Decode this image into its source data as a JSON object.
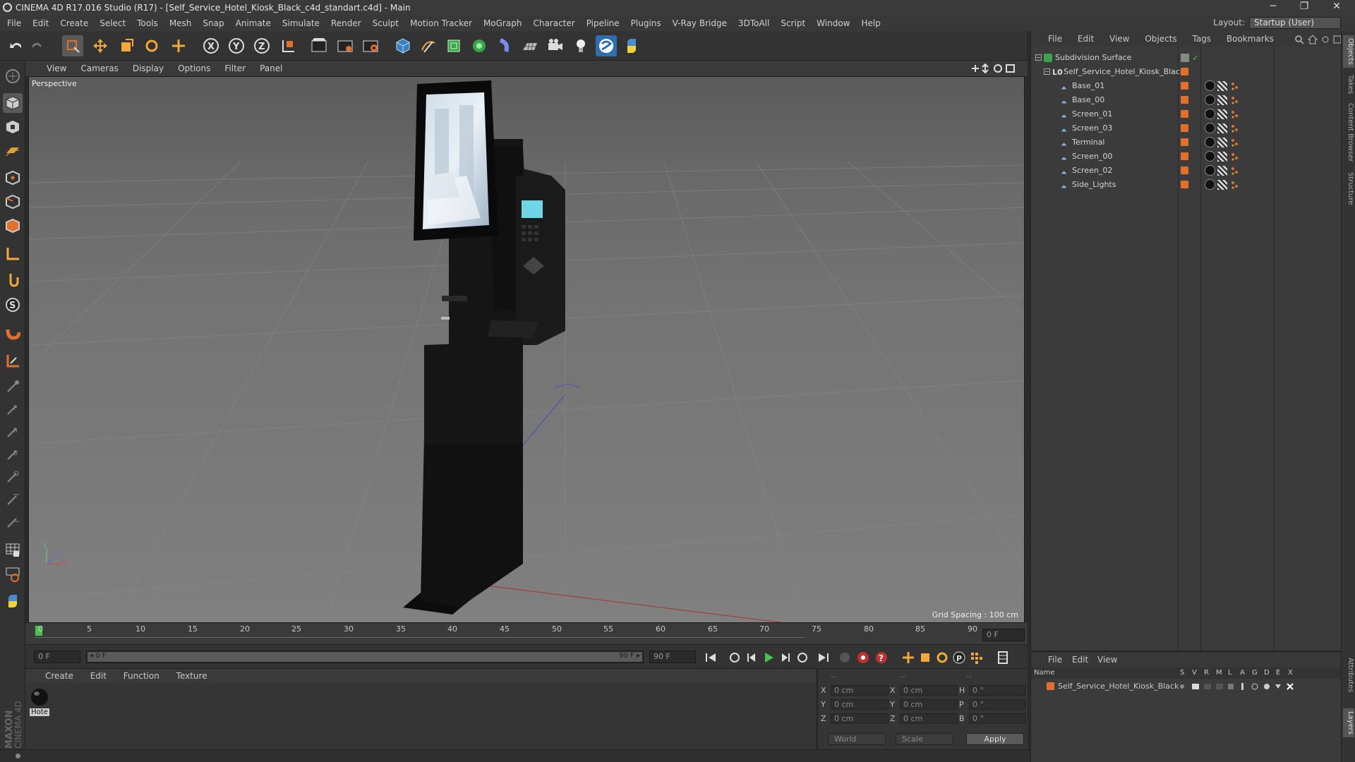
{
  "window": {
    "title": "CINEMA 4D R17.016 Studio (R17) - [Self_Service_Hotel_Kiosk_Black_c4d_standart.c4d] - Main",
    "minimize": "─",
    "restore": "❐",
    "close": "✕"
  },
  "menu": [
    "File",
    "Edit",
    "Create",
    "Select",
    "Tools",
    "Mesh",
    "Snap",
    "Animate",
    "Simulate",
    "Render",
    "Sculpt",
    "Motion Tracker",
    "MoGraph",
    "Character",
    "Pipeline",
    "Plugins",
    "V-Ray Bridge",
    "3DToAll",
    "Script",
    "Window",
    "Help"
  ],
  "layout": {
    "label": "Layout:",
    "value": "Startup (User)"
  },
  "viewport": {
    "menu": [
      "View",
      "Cameras",
      "Display",
      "Options",
      "Filter",
      "Panel"
    ],
    "camera_label": "Perspective",
    "grid_spacing": "Grid Spacing : 100 cm",
    "axis_y": "Y",
    "axis_z": "Z",
    "axis_x": "X"
  },
  "timeline": {
    "ticks": [
      "0",
      "5",
      "10",
      "15",
      "20",
      "25",
      "30",
      "35",
      "40",
      "45",
      "50",
      "55",
      "60",
      "65",
      "70",
      "75",
      "80",
      "85",
      "90"
    ],
    "current_frame": "0 F",
    "start": "0 F",
    "range_start": "◂ 0 F",
    "range_end": "90 F ▸",
    "end": "90 F"
  },
  "material_manager": {
    "menu": [
      "Create",
      "Edit",
      "Function",
      "Texture"
    ],
    "materials": [
      {
        "name": "Hote"
      }
    ]
  },
  "coordinates": {
    "headers": [
      "--",
      "--",
      "--"
    ],
    "rows": [
      {
        "a": "X",
        "av": "0 cm",
        "b": "X",
        "bv": "0 cm",
        "c": "H",
        "cv": "0 °"
      },
      {
        "a": "Y",
        "av": "0 cm",
        "b": "Y",
        "bv": "0 cm",
        "c": "P",
        "cv": "0 °"
      },
      {
        "a": "Z",
        "av": "0 cm",
        "b": "Z",
        "bv": "0 cm",
        "c": "B",
        "cv": "0 °"
      }
    ],
    "mode1": "World",
    "mode2": "Scale",
    "apply": "Apply"
  },
  "object_manager": {
    "menu": [
      "File",
      "Edit",
      "View",
      "Objects",
      "Tags",
      "Bookmarks"
    ],
    "objects": [
      {
        "name": "Subdivision Surface",
        "level": 0
      },
      {
        "name": "Self_Service_Hotel_Kiosk_Black",
        "level": 1
      },
      {
        "name": "Base_01",
        "level": 2
      },
      {
        "name": "Base_00",
        "level": 2
      },
      {
        "name": "Screen_01",
        "level": 2
      },
      {
        "name": "Screen_03",
        "level": 2
      },
      {
        "name": "Terminal",
        "level": 2
      },
      {
        "name": "Screen_00",
        "level": 2
      },
      {
        "name": "Screen_02",
        "level": 2
      },
      {
        "name": "Side_Lights",
        "level": 2
      }
    ]
  },
  "layer_manager": {
    "menu": [
      "File",
      "Edit",
      "View"
    ],
    "columns": [
      "Name",
      "S",
      "V",
      "R",
      "M",
      "L",
      "A",
      "G",
      "D",
      "E",
      "X"
    ],
    "layers": [
      {
        "name": "Self_Service_Hotel_Kiosk_Black"
      }
    ]
  },
  "side_tabs": [
    "Objects",
    "Takes",
    "Content Browser",
    "Structure",
    "Attributes",
    "Layers"
  ],
  "branding": {
    "maxon": "MAXON",
    "product": "CINEMA 4D"
  },
  "colors": {
    "accent_orange": "#e0702a",
    "highlight_green": "#4ec04e",
    "active_blue": "#2f6fb0"
  }
}
